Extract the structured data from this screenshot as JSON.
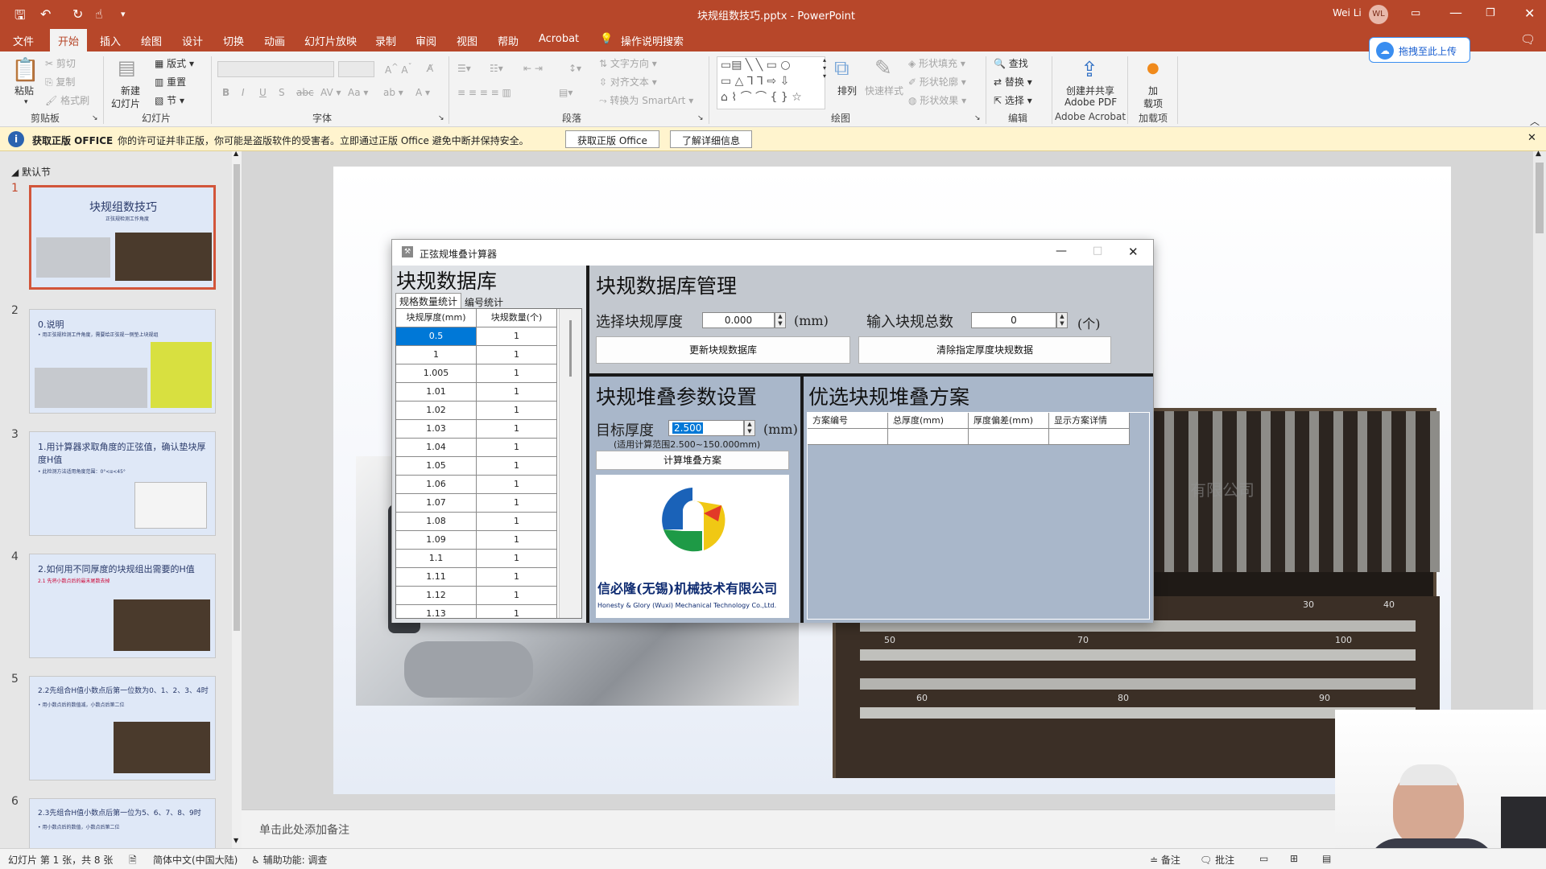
{
  "window": {
    "title": "块规组数技巧.pptx - PowerPoint",
    "user_name": "Wei Li",
    "user_initials": "WL"
  },
  "tabs": [
    "文件",
    "开始",
    "插入",
    "绘图",
    "设计",
    "切换",
    "动画",
    "幻灯片放映",
    "录制",
    "审阅",
    "视图",
    "帮助",
    "Acrobat",
    "操作说明搜索"
  ],
  "active_tab": "开始",
  "upload_button": "拖拽至此上传",
  "ribbon": {
    "clipboard": {
      "paste": "粘贴",
      "cut": "剪切",
      "copy": "复制",
      "format_painter": "格式刷",
      "label": "剪贴板"
    },
    "slides": {
      "new_slide_line1": "新建",
      "new_slide_line2": "幻灯片",
      "layout": "版式",
      "reset": "重置",
      "section": "节",
      "label": "幻灯片"
    },
    "font": {
      "label": "字体"
    },
    "paragraph": {
      "text_direction": "文字方向",
      "align_text": "对齐文本",
      "convert_smartart": "转换为 SmartArt",
      "label": "段落"
    },
    "drawing": {
      "arrange": "排列",
      "quick_styles": "快速样式",
      "shape_fill": "形状填充",
      "shape_outline": "形状轮廓",
      "shape_effects": "形状效果",
      "label": "绘图"
    },
    "editing": {
      "find": "查找",
      "replace": "替换",
      "select": "选择",
      "label": "编辑"
    },
    "acrobat": {
      "create_line1": "创建并共享",
      "create_line2": "Adobe PDF",
      "label": "Adobe Acrobat"
    },
    "addins": {
      "line1": "加",
      "line2": "载项",
      "label": "加载项"
    }
  },
  "warning": {
    "title": "获取正版 OFFICE",
    "message": "你的许可证并非正版，你可能是盗版软件的受害者。立即通过正版 Office 避免中断并保持安全。",
    "btn_genuine": "获取正版 Office",
    "btn_learn": "了解详细信息"
  },
  "thumbnails": {
    "section": "默认节",
    "slides": [
      {
        "num": "1",
        "title": "块规组数技巧",
        "sub": "正弦规检测工作角度"
      },
      {
        "num": "2",
        "title": "0.说明",
        "sub": "• 用正弦规检测工件角度，需要给正弦规一侧垫上块规组"
      },
      {
        "num": "3",
        "title": "1.用计算器求取角度的正弦值，确认垫块厚度H值",
        "sub": "• 此检测方法适用角度范围：0°<α<45°"
      },
      {
        "num": "4",
        "title": "2.如何用不同厚度的块规组出需要的H值",
        "sub": "2.1 先将小数点后的最末尾数去掉"
      },
      {
        "num": "5",
        "title": "2.2先组合H值小数点后第一位数为0、1、2、3、4时",
        "sub": "• 用小数点后的数值减，小数点后第二位"
      },
      {
        "num": "6",
        "title": "2.3先组合H值小数点后第一位为5、6、7、8、9时",
        "sub": "• 用小数点后的数值，小数点后第二位"
      }
    ]
  },
  "notes_placeholder": "单击此处添加备注",
  "dialog": {
    "title": "正弦规堆叠计算器",
    "db_title": "块规数据库",
    "tab1": "规格数量统计",
    "tab2": "编号统计",
    "col1": "块规厚度(mm)",
    "col2": "块规数量(个)",
    "rows": [
      {
        "t": "0.5",
        "q": "1"
      },
      {
        "t": "1",
        "q": "1"
      },
      {
        "t": "1.005",
        "q": "1"
      },
      {
        "t": "1.01",
        "q": "1"
      },
      {
        "t": "1.02",
        "q": "1"
      },
      {
        "t": "1.03",
        "q": "1"
      },
      {
        "t": "1.04",
        "q": "1"
      },
      {
        "t": "1.05",
        "q": "1"
      },
      {
        "t": "1.06",
        "q": "1"
      },
      {
        "t": "1.07",
        "q": "1"
      },
      {
        "t": "1.08",
        "q": "1"
      },
      {
        "t": "1.09",
        "q": "1"
      },
      {
        "t": "1.1",
        "q": "1"
      },
      {
        "t": "1.11",
        "q": "1"
      },
      {
        "t": "1.12",
        "q": "1"
      },
      {
        "t": "1.13",
        "q": "1"
      }
    ],
    "mgmt_title": "块规数据库管理",
    "select_thickness_label": "选择块规厚度",
    "select_thickness_value": "0.000",
    "unit_mm": "(mm)",
    "total_label": "输入块规总数",
    "total_value": "0",
    "unit_count": "(个)",
    "update_btn": "更新块规数据库",
    "clear_btn": "清除指定厚度块规数据",
    "param_title": "块规堆叠参数设置",
    "target_label": "目标厚度",
    "target_value": "2.500",
    "range_note": "(适用计算范围2.500~150.000mm)",
    "calc_btn": "计算堆叠方案",
    "company_cn": "信必隆(无锡)机械技术有限公司",
    "company_en": "Honesty & Glory (Wuxi) Mechanical Technology Co.,Ltd.",
    "result_title": "优选块规堆叠方案",
    "rcol1": "方案编号",
    "rcol2": "总厚度(mm)",
    "rcol3": "厚度偏差(mm)",
    "rcol4": "显示方案详情"
  },
  "slide_bg_text": {
    "watermark": "有限公司",
    "n30": "30",
    "n40": "40",
    "n50": "50",
    "n70": "70",
    "n100": "100",
    "n60": "60",
    "n80": "80",
    "n90": "90"
  },
  "statusbar": {
    "slide_info": "幻灯片 第 1 张，共 8 张",
    "language": "简体中文(中国大陆)",
    "accessibility": "辅助功能: 调查",
    "notes": "备注",
    "comments": "批注"
  },
  "colors": {
    "accent": "#b7472a",
    "selection": "#0078d7",
    "panel": "#aab7c9",
    "warn": "#fff4ce"
  }
}
